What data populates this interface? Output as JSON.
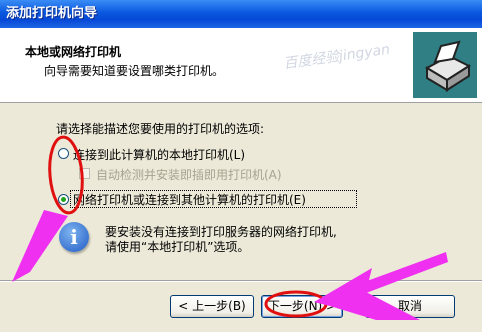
{
  "window": {
    "title": "添加打印机向导"
  },
  "header": {
    "title": "本地或网络打印机",
    "subtitle": "向导需要知道要设置哪类打印机。",
    "watermark": "百度经验jingyan"
  },
  "body": {
    "prompt": "请选择能描述您要使用的打印机的选项:",
    "options": [
      {
        "label": "连接到此计算机的本地打印机(L)",
        "selected": false
      },
      {
        "label": "自动检测并安装即插即用打印机(A)",
        "checked": false,
        "enabled": false
      },
      {
        "label": "网络打印机或连接到其他计算机的打印机(E)",
        "selected": true
      }
    ],
    "info_line1": "要安装没有连接到打印服务器的网络打印机,",
    "info_line2": "请使用“本地打印机”选项。"
  },
  "buttons": {
    "back": "< 上一步(B)",
    "next": "下一步(N) >",
    "cancel": "取消"
  },
  "colors": {
    "title_bar": "#0A58E0",
    "annotation": "#F030F0",
    "highlight_circle": "#E01010"
  },
  "icons": {
    "header": "printer-icon",
    "info": "info-icon"
  }
}
